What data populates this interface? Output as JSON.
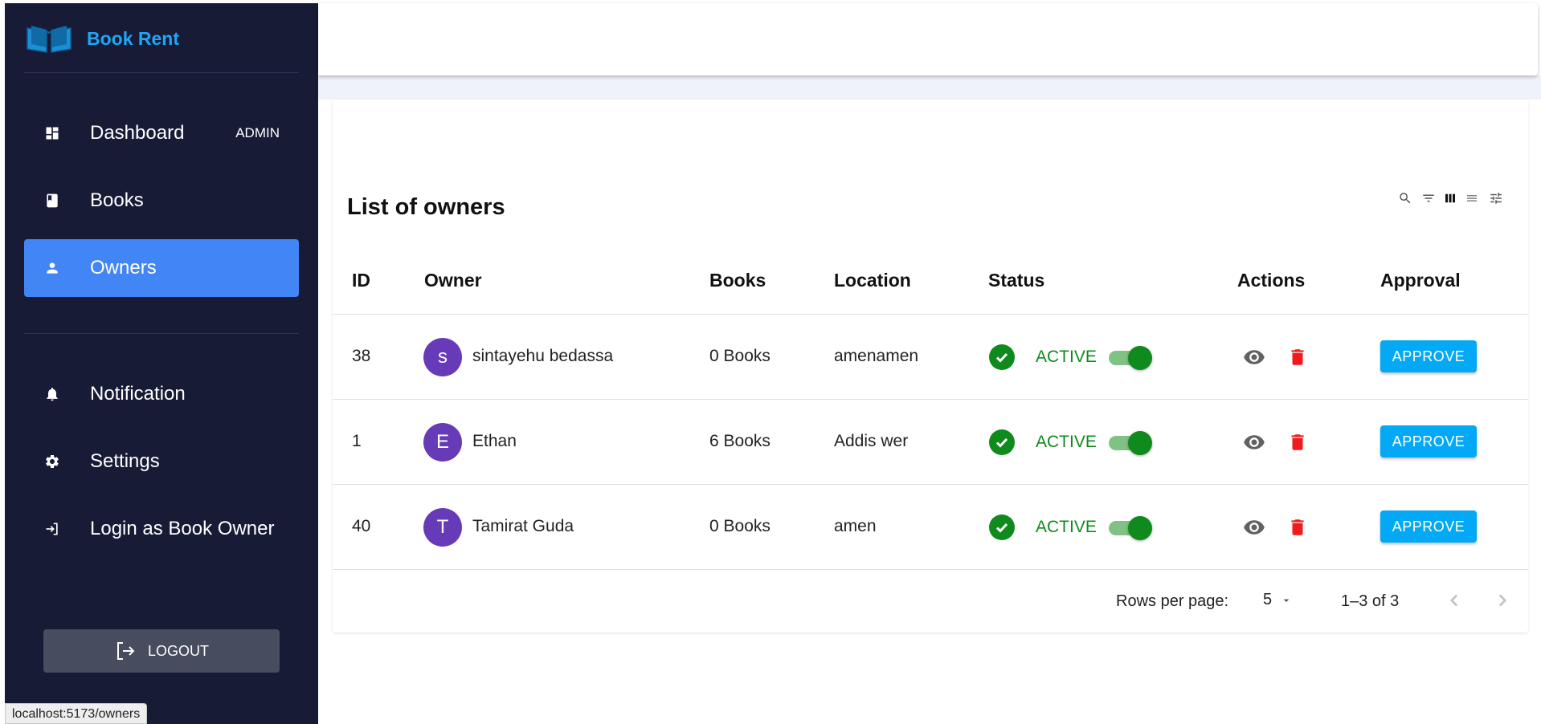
{
  "app": {
    "brand": "Book Rent"
  },
  "sidebar": {
    "items": [
      {
        "label": "Dashboard",
        "badge": "ADMIN",
        "icon": "dashboard-icon"
      },
      {
        "label": "Books",
        "icon": "book-icon"
      },
      {
        "label": "Owners",
        "icon": "person-icon",
        "active": true
      },
      {
        "label": "Notification",
        "icon": "bell-icon"
      },
      {
        "label": "Settings",
        "icon": "gear-icon"
      },
      {
        "label": "Login as Book Owner",
        "icon": "login-icon"
      }
    ],
    "logout_label": "LOGOUT"
  },
  "status_bar": {
    "url": "localhost:5173/owners"
  },
  "card": {
    "title": "List of owners",
    "toolbar_icons": [
      "search-icon",
      "filter-icon",
      "columns-icon",
      "density-icon",
      "settings-sliders-icon"
    ]
  },
  "table": {
    "headers": {
      "id": "ID",
      "owner": "Owner",
      "books": "Books",
      "location": "Location",
      "status": "Status",
      "actions": "Actions",
      "approval": "Approval"
    },
    "rows": [
      {
        "id": "38",
        "initial": "s",
        "owner": "sintayehu bedassa",
        "books": "0 Books",
        "location": "amenamen",
        "status": "ACTIVE",
        "active": true,
        "approve": "APPROVE"
      },
      {
        "id": "1",
        "initial": "E",
        "owner": "Ethan",
        "books": "6 Books",
        "location": "Addis wer",
        "status": "ACTIVE",
        "active": true,
        "approve": "APPROVE"
      },
      {
        "id": "40",
        "initial": "T",
        "owner": "Tamirat Guda",
        "books": "0 Books",
        "location": "amen",
        "status": "ACTIVE",
        "active": true,
        "approve": "APPROVE"
      }
    ]
  },
  "pagination": {
    "rows_per_page_label": "Rows per page:",
    "rows_per_page_value": "5",
    "range": "1–3 of 3"
  },
  "colors": {
    "sidebar_bg": "#171b36",
    "active_nav": "#4285f4",
    "brand": "#1ea7f7",
    "status_active": "#0f8a1c",
    "approve_button": "#03a9f4",
    "delete": "#f21b1b",
    "avatar": "#673ab7"
  }
}
